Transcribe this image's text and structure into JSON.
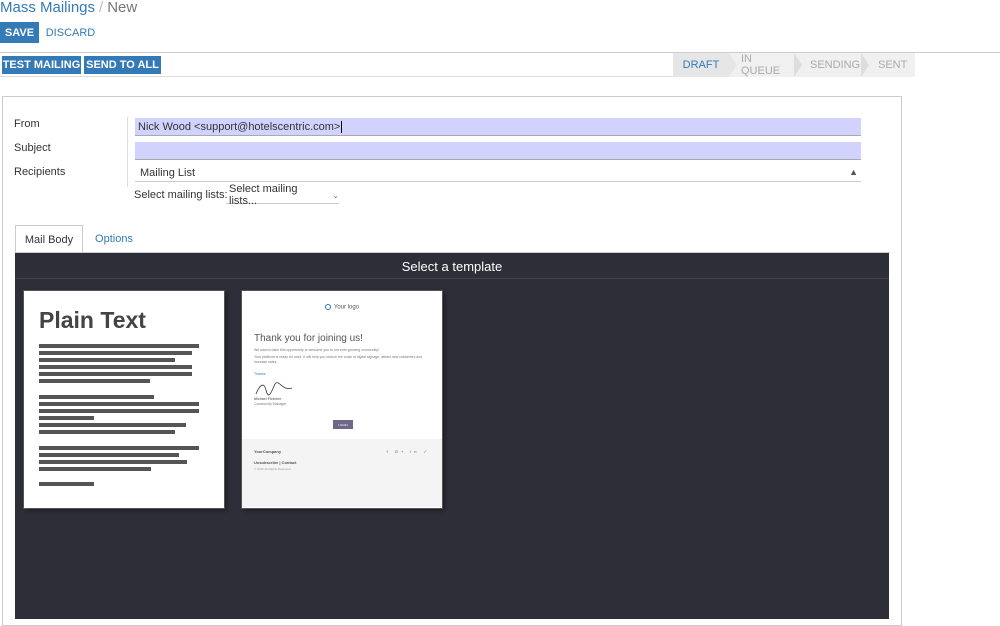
{
  "breadcrumb": {
    "parent": "Mass Mailings",
    "separator": "/",
    "current": "New"
  },
  "actions": {
    "save": "SAVE",
    "discard": "DISCARD"
  },
  "header_buttons": {
    "test_mailing": "TEST MAILING",
    "send_to_all": "SEND TO ALL"
  },
  "status": {
    "stages": [
      "DRAFT",
      "IN QUEUE",
      "SENDING",
      "SENT"
    ],
    "active": "DRAFT"
  },
  "form": {
    "from_label": "From",
    "from_value": "Nick Wood <support@hotelscentric.com>",
    "subject_label": "Subject",
    "subject_value": "",
    "recipients_label": "Recipients",
    "recipients_value": "Mailing List",
    "mailing_lists_label": "Select mailing lists:",
    "mailing_lists_placeholder": "Select mailing lists..."
  },
  "tabs": {
    "mail_body": "Mail Body",
    "options": "Options"
  },
  "editor": {
    "title": "Select a template",
    "templates": {
      "plain_text": {
        "title": "Plain Text"
      },
      "thank_you": {
        "logo": "Your logo",
        "title": "Thank you for joining us!",
        "line1": "We want to take this opportunity to welcome you to our ever-growing community!",
        "line2": "Your platform is ready for work. It will help you reduce the costs of digital signage, attract new customers and increase sales.",
        "line3": "Thanks",
        "signer_name": "Michael Fletcher",
        "signer_role": "Community Manager",
        "button": "LOGIN",
        "company": "YourCompany",
        "links": "Unsubscribe | Contact",
        "rights": "© 2016 All Rights Reserved",
        "social": "f G+ in ✓"
      }
    }
  },
  "colors": {
    "primary": "#337ab7",
    "editor_bg": "#2e2e38",
    "required_field": "#d2d2ff"
  }
}
